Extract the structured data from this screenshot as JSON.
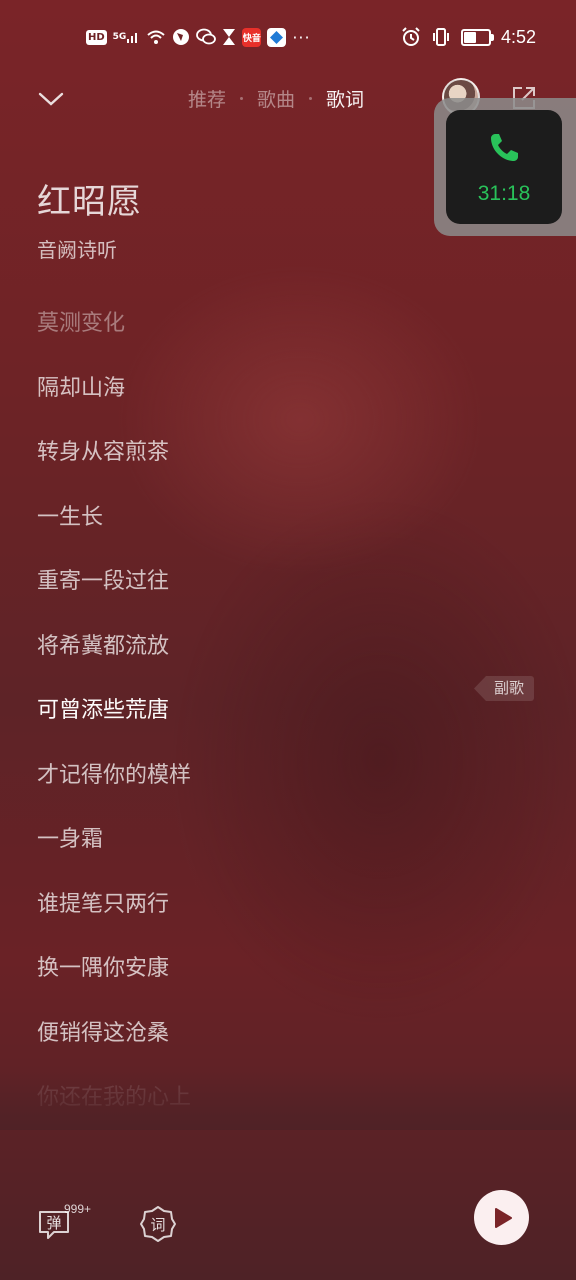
{
  "statusbar": {
    "hd": "HD",
    "network": "5G",
    "app_badge_red": "快音",
    "dots": "···",
    "time": "4:52",
    "battery_level": 0.45
  },
  "nav": {
    "tabs": [
      {
        "label": "推荐"
      },
      {
        "label": "歌曲"
      },
      {
        "label": "歌词"
      }
    ],
    "active_tab": "歌词"
  },
  "call": {
    "timer": "31:18",
    "accent": "#29c25a"
  },
  "song": {
    "title": "红昭愿",
    "artist": "音阙诗听"
  },
  "lyrics": [
    {
      "text": "莫测变化",
      "state": "dim"
    },
    {
      "text": "隔却山海",
      "state": "normal"
    },
    {
      "text": "转身从容煎茶",
      "state": "normal"
    },
    {
      "text": "一生长",
      "state": "normal"
    },
    {
      "text": "重寄一段过往",
      "state": "normal"
    },
    {
      "text": "将希冀都流放",
      "state": "normal"
    },
    {
      "text": "可曾添些荒唐",
      "state": "active"
    },
    {
      "text": "才记得你的模样",
      "state": "normal"
    },
    {
      "text": "一身霜",
      "state": "normal"
    },
    {
      "text": "谁提笔只两行",
      "state": "normal"
    },
    {
      "text": "换一隅你安康",
      "state": "normal"
    },
    {
      "text": "便销得这沧桑",
      "state": "normal"
    },
    {
      "text": "你还在我的心上",
      "state": "fade"
    }
  ],
  "chorus_tag": "副歌",
  "bottom": {
    "danmu_label": "弹",
    "danmu_count": "999+",
    "lyric_label": "词"
  },
  "colors": {
    "background": "#6e2326",
    "play_button": "#fbeff0",
    "play_icon": "#7a2428"
  }
}
